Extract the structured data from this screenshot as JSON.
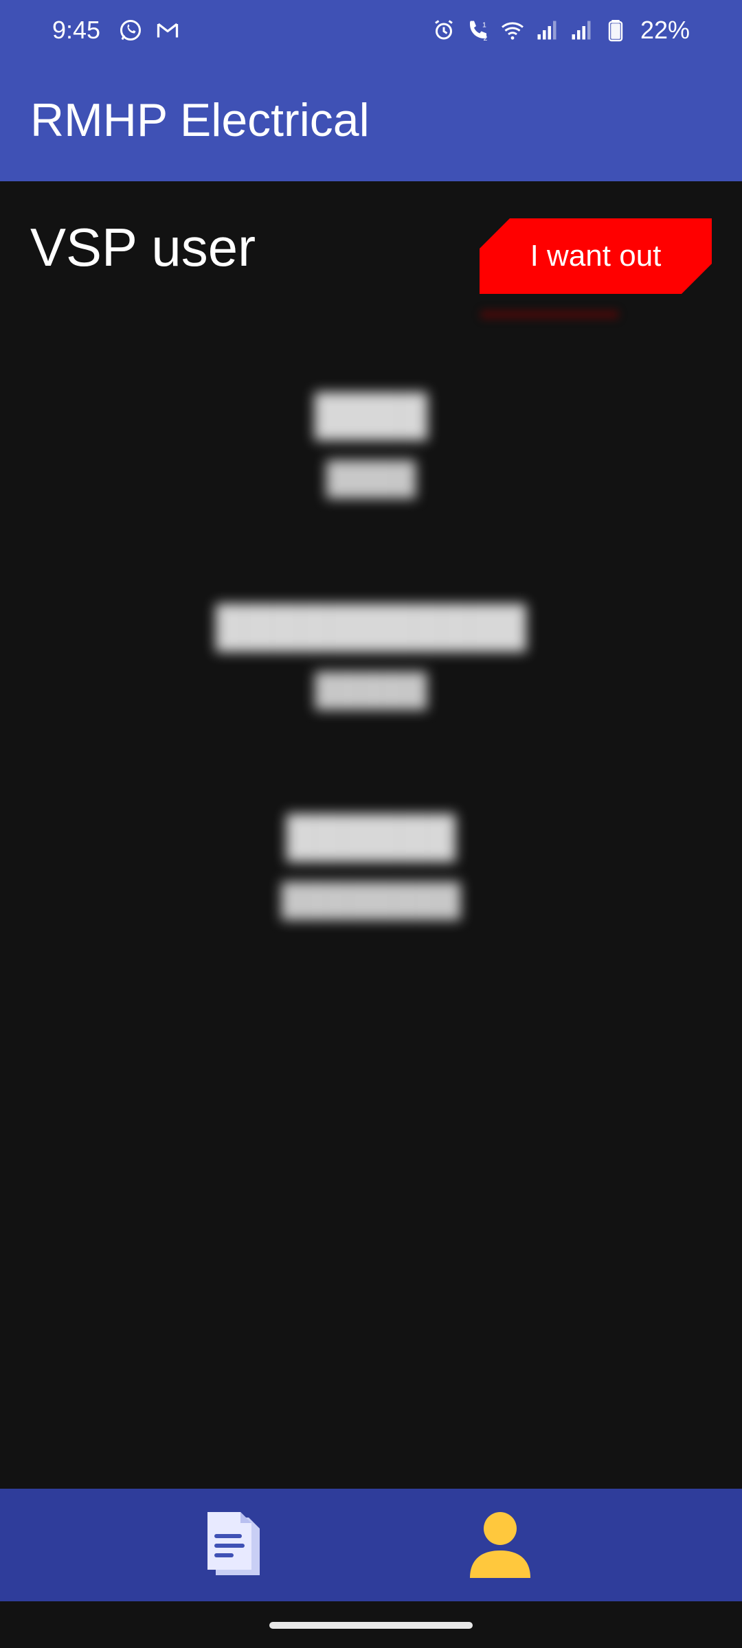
{
  "status_bar": {
    "time": "9:45",
    "battery": "22%",
    "left_icons": [
      "whatsapp-icon",
      "gmail-icon"
    ],
    "right_icons": [
      "alarm-icon",
      "wifi-calling-icon",
      "wifi-icon",
      "signal-icon",
      "signal-icon",
      "battery-icon"
    ]
  },
  "app_bar": {
    "title": "RMHP Electrical"
  },
  "page": {
    "heading": "VSP user",
    "logout_label": "I want out",
    "logout_color": "#ff0000"
  },
  "colors": {
    "primary": "#3f51b5",
    "bottom_nav": "#2f3d9b",
    "background": "#121212",
    "active_nav": "#ffc83d",
    "inactive_nav": "#e8eaff"
  },
  "bottom_nav": {
    "items": [
      {
        "icon": "documents-icon",
        "active": false
      },
      {
        "icon": "profile-icon",
        "active": true
      }
    ]
  }
}
